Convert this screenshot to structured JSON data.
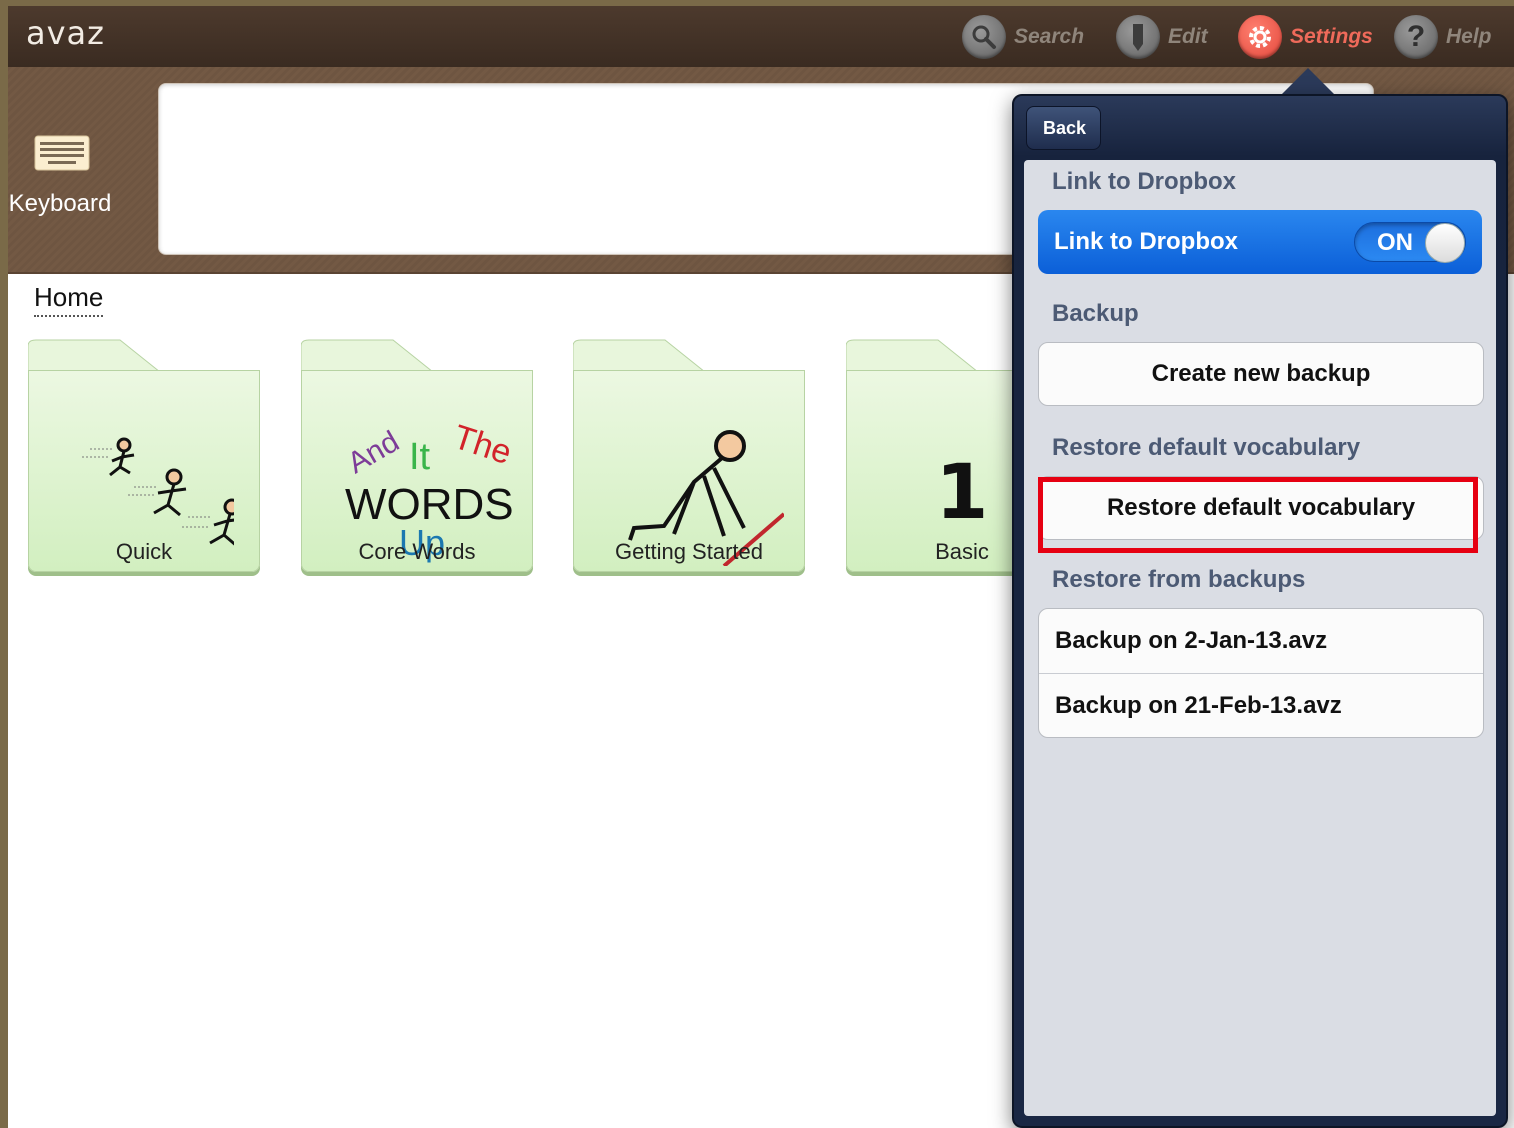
{
  "app": {
    "logo": "avaz"
  },
  "topbar": {
    "search_label": "Search",
    "edit_label": "Edit",
    "settings_label": "Settings",
    "help_label": "Help"
  },
  "strip": {
    "keyboard_label": "Keyboard"
  },
  "breadcrumb": {
    "home": "Home"
  },
  "folders": [
    {
      "name": "Quick"
    },
    {
      "name": "Core Words",
      "art": {
        "and": "And",
        "it": "It",
        "the": "The",
        "words": "WORDS",
        "up": "Up"
      }
    },
    {
      "name": "Getting Started"
    },
    {
      "name": "Basic",
      "glyph": "1"
    }
  ],
  "settings_popover": {
    "back_label": "Back",
    "sections": {
      "dropbox_header": "Link to Dropbox",
      "dropbox_cell": "Link to Dropbox",
      "dropbox_toggle": "ON",
      "backup_header": "Backup",
      "backup_button": "Create new backup",
      "restore_header": "Restore default vocabulary",
      "restore_button": "Restore default vocabulary",
      "backups_header": "Restore from backups",
      "backups": [
        "Backup on 2-Jan-13.avz",
        "Backup on 21-Feb-13.avz"
      ]
    }
  },
  "colors": {
    "accent_active": "#ef6a5a",
    "toggle_blue": "#0b5fd8",
    "highlight": "#e60012"
  }
}
